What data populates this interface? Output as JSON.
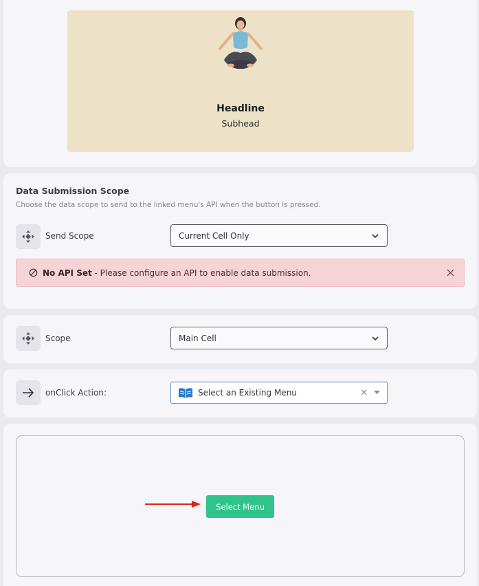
{
  "preview": {
    "headline": "Headline",
    "subhead": "Subhead",
    "background_color": "#ede1c8",
    "image_icon": "meditation-woman-image"
  },
  "data_submission": {
    "title": "Data Submission Scope",
    "description": "Choose the data scope to send to the linked menu's API when the button is pressed.",
    "send_scope": {
      "label": "Send Scope",
      "icon": "move-arrows-icon",
      "value": "Current Cell Only"
    },
    "alert": {
      "icon": "prohibited-icon",
      "bold": "No API Set",
      "message": " - Please configure an API to enable data submission.",
      "close_icon": "close-icon"
    }
  },
  "scope": {
    "label": "Scope",
    "icon": "move-arrows-icon",
    "value": "Main Cell"
  },
  "onclick": {
    "label": "onClick Action:",
    "icon": "arrow-right-icon",
    "placeholder": "Select an Existing Menu",
    "select_icon": "book-icon"
  },
  "canvas": {
    "button_label": "Select Menu",
    "button_color": "#2fc48a",
    "arrow_color": "#e0211b"
  }
}
